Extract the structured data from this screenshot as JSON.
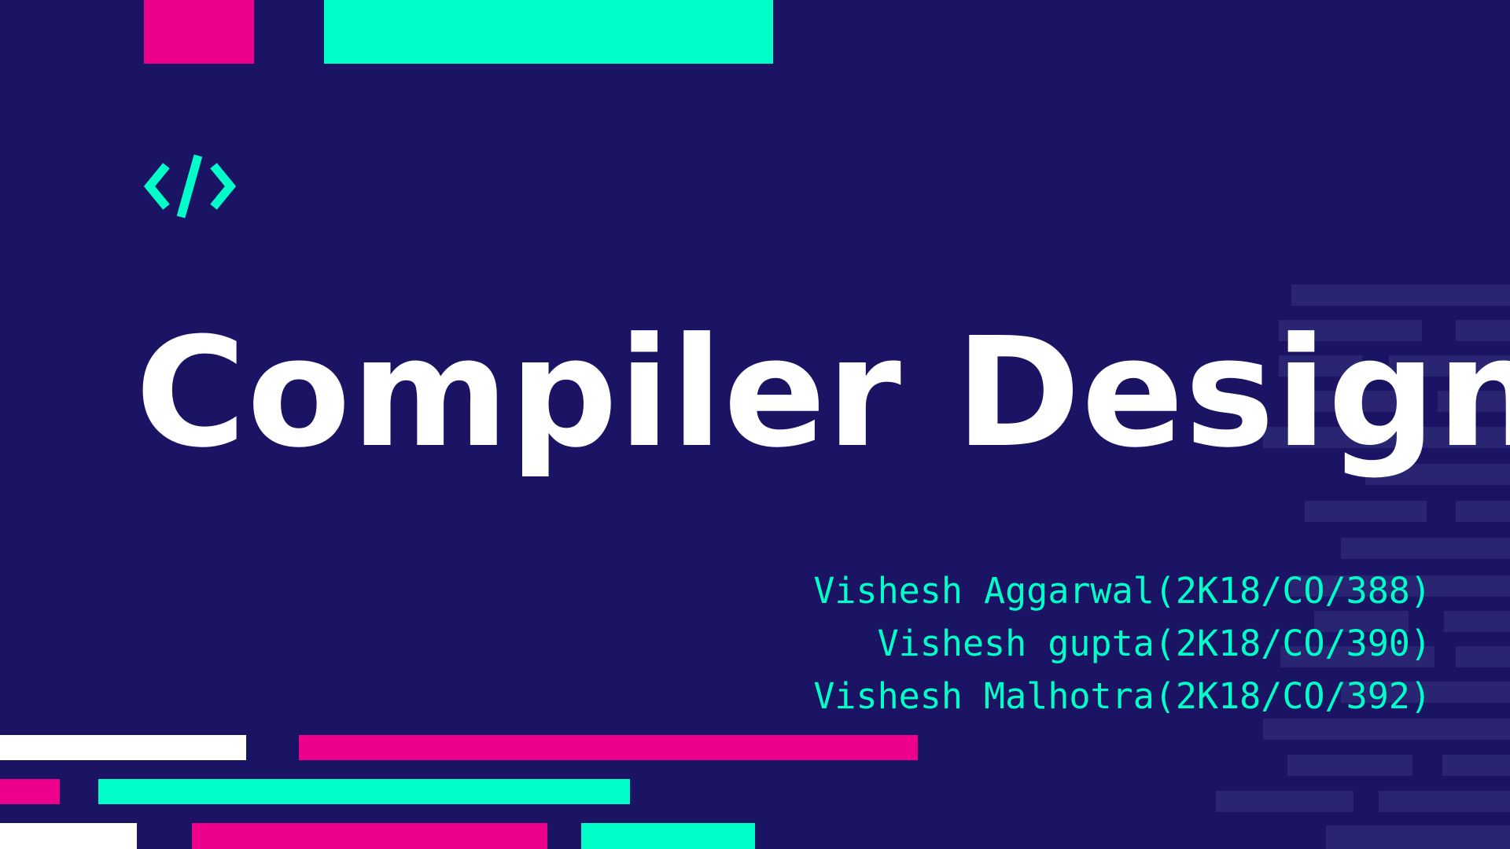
{
  "slide": {
    "title": "Compiler Design",
    "icon": "code-brackets-icon",
    "authors": [
      "Vishesh Aggarwal(2K18/CO/388)",
      "Vishesh gupta(2K18/CO/390)",
      "Vishesh Malhotra(2K18/CO/392)"
    ]
  },
  "colors": {
    "background": "#1b1464",
    "accent_teal": "#00ffc8",
    "accent_pink": "#ec008c",
    "text_white": "#ffffff",
    "ghost_bars": "#2a2573"
  }
}
